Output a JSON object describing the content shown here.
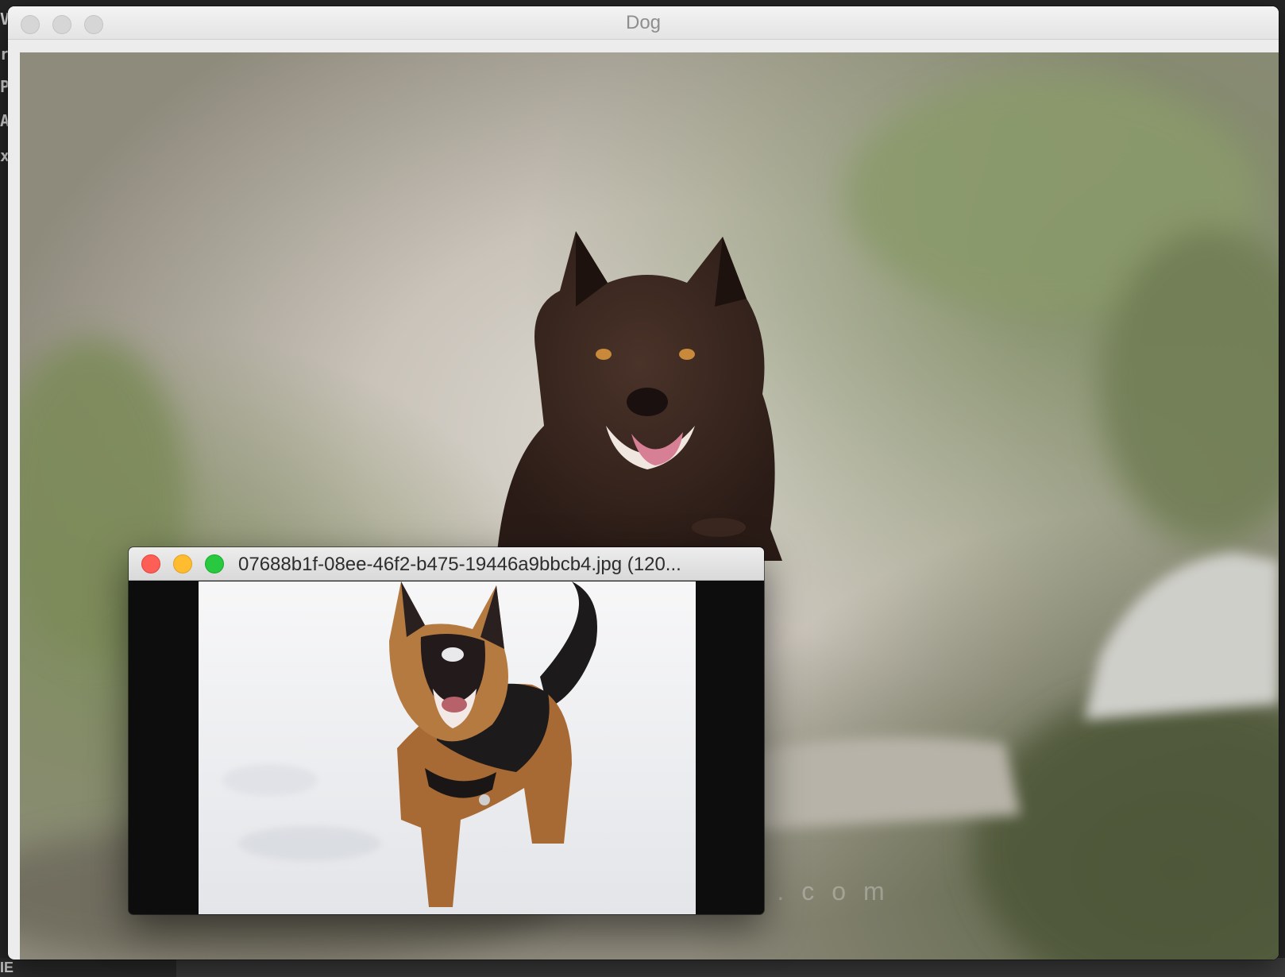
{
  "background_editor": {
    "gutter_chars": [
      "V",
      "r",
      "P",
      "A",
      "x"
    ],
    "status_text": "IE"
  },
  "main_window": {
    "title": "Dog",
    "image": {
      "subject": "brown dog running toward camera in misty forest",
      "watermark": "claudiopiccoli.com"
    }
  },
  "preview_window": {
    "title": "07688b1f-08ee-46f2-b475-19446a9bbcb4.jpg (120...",
    "image": {
      "subject": "german shepherd puppy barking in snow"
    }
  },
  "colors": {
    "close": "#fd5f57",
    "minimize": "#febc2e",
    "zoom": "#28c840",
    "titlebar": "#ececec",
    "inactive_light": "#d6d6d6"
  }
}
